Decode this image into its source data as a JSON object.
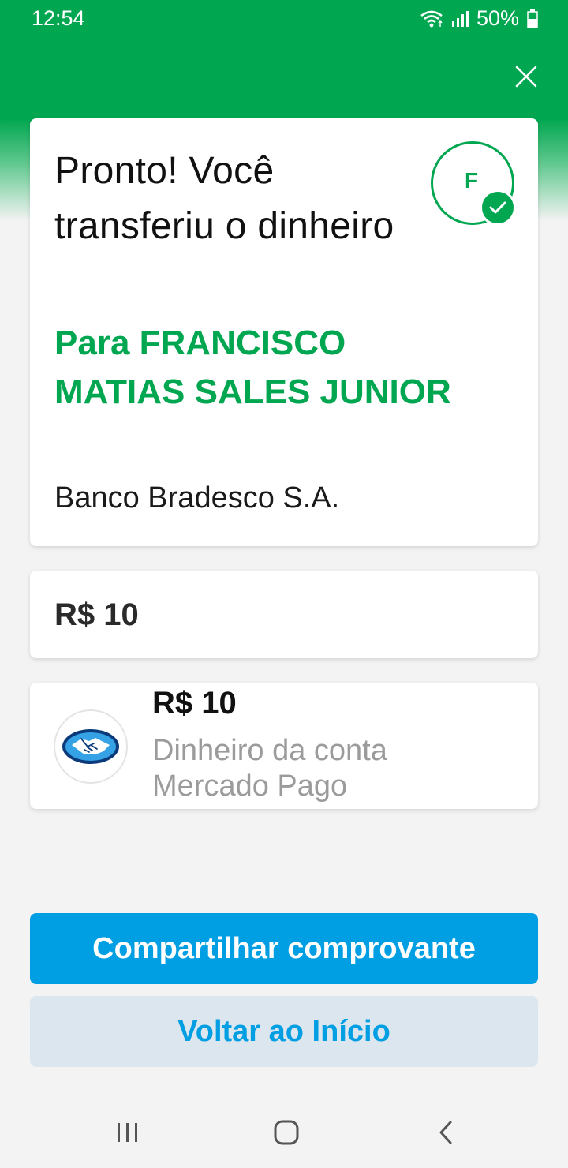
{
  "status_bar": {
    "time": "12:54",
    "battery": "50%",
    "icons": [
      "wifi-icon",
      "signal-icon",
      "battery-icon"
    ]
  },
  "header": {
    "close_icon": "close-icon",
    "color": "#00a650"
  },
  "confirmation": {
    "title": "Pronto! Você transferiu o dinheiro",
    "recipient": "Para FRANCISCO MATIAS SALES JUNIOR",
    "bank": "Banco Bradesco S.A.",
    "avatar_initial": "F"
  },
  "amount": {
    "value": "R$ 10"
  },
  "payment_method": {
    "amount": "R$ 10",
    "description": "Dinheiro da conta Mercado Pago",
    "logo": "mercado-pago-logo"
  },
  "actions": {
    "share_label": "Compartilhar comprovante",
    "home_label": "Voltar ao Início"
  },
  "colors": {
    "brand_green": "#00a650",
    "primary_blue": "#009ee3",
    "secondary_bg": "#dbe6ee"
  }
}
